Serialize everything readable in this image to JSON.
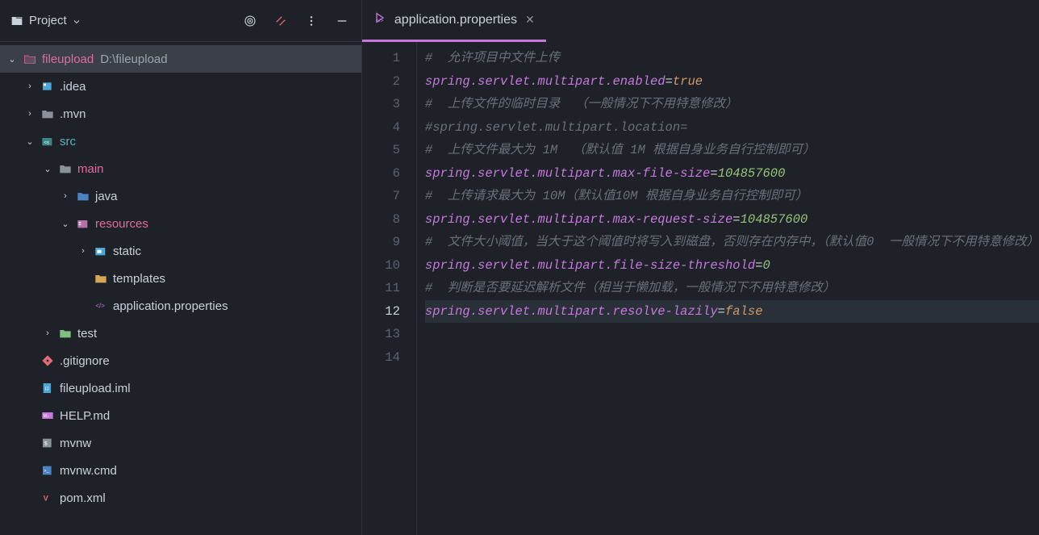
{
  "sidebar": {
    "title": "Project",
    "icons": {
      "target": "target-icon",
      "collapse": "collapse-icon",
      "more": "more-icon",
      "minimize": "minimize-icon"
    }
  },
  "tree": [
    {
      "indent": 0,
      "arrow": "down",
      "icon": "folder-pink",
      "name": "fileupload",
      "nameClass": "t-pink",
      "extra": "D:\\fileupload",
      "extraClass": "t-gray",
      "interact": true
    },
    {
      "indent": 1,
      "arrow": "right",
      "icon": "folder-idea",
      "name": ".idea",
      "nameClass": "t-white",
      "interact": true
    },
    {
      "indent": 1,
      "arrow": "right",
      "icon": "folder-gray",
      "name": ".mvn",
      "nameClass": "t-white",
      "interact": true
    },
    {
      "indent": 1,
      "arrow": "down",
      "icon": "folder-src",
      "name": "src",
      "nameClass": "t-cyan",
      "interact": true
    },
    {
      "indent": 2,
      "arrow": "down",
      "icon": "folder-gray",
      "name": "main",
      "nameClass": "t-pink",
      "interact": true
    },
    {
      "indent": 3,
      "arrow": "right",
      "icon": "folder-blue",
      "name": "java",
      "nameClass": "t-white",
      "interact": true
    },
    {
      "indent": 3,
      "arrow": "down",
      "icon": "folder-res",
      "name": "resources",
      "nameClass": "t-pink",
      "interact": true
    },
    {
      "indent": 4,
      "arrow": "right",
      "icon": "folder-static",
      "name": "static",
      "nameClass": "t-white",
      "interact": true
    },
    {
      "indent": 4,
      "arrow": "empty",
      "icon": "folder-yellow",
      "name": "templates",
      "nameClass": "t-white",
      "interact": true
    },
    {
      "indent": 4,
      "arrow": "empty",
      "icon": "file-props",
      "name": "application.properties",
      "nameClass": "t-white",
      "interact": true
    },
    {
      "indent": 2,
      "arrow": "right",
      "icon": "folder-test",
      "name": "test",
      "nameClass": "t-white",
      "interact": true
    },
    {
      "indent": 1,
      "arrow": "empty",
      "icon": "file-git",
      "name": ".gitignore",
      "nameClass": "t-white",
      "interact": true
    },
    {
      "indent": 1,
      "arrow": "empty",
      "icon": "file-iml",
      "name": "fileupload.iml",
      "nameClass": "t-white",
      "interact": true
    },
    {
      "indent": 1,
      "arrow": "empty",
      "icon": "file-md",
      "name": "HELP.md",
      "nameClass": "t-white",
      "interact": true
    },
    {
      "indent": 1,
      "arrow": "empty",
      "icon": "file-sh",
      "name": "mvnw",
      "nameClass": "t-white",
      "interact": true
    },
    {
      "indent": 1,
      "arrow": "empty",
      "icon": "file-cmd",
      "name": "mvnw.cmd",
      "nameClass": "t-white",
      "interact": true
    },
    {
      "indent": 1,
      "arrow": "empty",
      "icon": "file-xml",
      "name": "pom.xml",
      "nameClass": "t-white",
      "interact": true
    }
  ],
  "tab": {
    "label": "application.properties"
  },
  "code": [
    {
      "n": 1,
      "cur": false,
      "seg": [
        {
          "t": "#  允许项目中文件上传",
          "c": "c-comment"
        }
      ]
    },
    {
      "n": 2,
      "cur": false,
      "seg": [
        {
          "t": "spring.servlet.multipart.enabled",
          "c": "c-key"
        },
        {
          "t": "=",
          "c": "c-eq"
        },
        {
          "t": "true",
          "c": "c-val"
        }
      ]
    },
    {
      "n": 3,
      "cur": false,
      "seg": [
        {
          "t": "#  上传文件的临时目录  （一般情况下不用特意修改）",
          "c": "c-comment"
        }
      ]
    },
    {
      "n": 4,
      "cur": false,
      "seg": [
        {
          "t": "#spring.servlet.multipart.location=",
          "c": "c-comment"
        }
      ]
    },
    {
      "n": 5,
      "cur": false,
      "seg": [
        {
          "t": "#  上传文件最大为 ",
          "c": "c-comment"
        },
        {
          "t": "1M",
          "c": "c-comment"
        },
        {
          "t": "  （默认值 ",
          "c": "c-comment"
        },
        {
          "t": "1M",
          "c": "c-comment"
        },
        {
          "t": " 根据自身业务自行控制即可）",
          "c": "c-comment"
        }
      ]
    },
    {
      "n": 6,
      "cur": false,
      "seg": [
        {
          "t": "spring.servlet.multipart.max-file-size",
          "c": "c-key"
        },
        {
          "t": "=",
          "c": "c-eq"
        },
        {
          "t": "104857600",
          "c": "c-num"
        }
      ]
    },
    {
      "n": 7,
      "cur": false,
      "seg": [
        {
          "t": "#  上传请求最大为 ",
          "c": "c-comment"
        },
        {
          "t": "10M",
          "c": "c-comment"
        },
        {
          "t": "（默认值",
          "c": "c-comment"
        },
        {
          "t": "10M",
          "c": "c-comment"
        },
        {
          "t": " 根据自身业务自行控制即可）",
          "c": "c-comment"
        }
      ]
    },
    {
      "n": 8,
      "cur": false,
      "seg": [
        {
          "t": "spring.servlet.multipart.max-request-size",
          "c": "c-key"
        },
        {
          "t": "=",
          "c": "c-eq"
        },
        {
          "t": "104857600",
          "c": "c-num"
        }
      ]
    },
    {
      "n": 9,
      "cur": false,
      "seg": [
        {
          "t": "#  文件大小阈值，当大于这个阈值时将写入到磁盘，否则存在内存中，（默认值",
          "c": "c-comment"
        },
        {
          "t": "0",
          "c": "c-comment"
        },
        {
          "t": "  一般情况下不用特意修改）",
          "c": "c-comment"
        }
      ]
    },
    {
      "n": 10,
      "cur": false,
      "seg": [
        {
          "t": "spring.servlet.multipart.file-size-threshold",
          "c": "c-key"
        },
        {
          "t": "=",
          "c": "c-eq"
        },
        {
          "t": "0",
          "c": "c-num"
        }
      ]
    },
    {
      "n": 11,
      "cur": false,
      "seg": [
        {
          "t": "#  判断是否要延迟解析文件（相当于懒加载，一般情况下不用特意修改）",
          "c": "c-comment"
        }
      ]
    },
    {
      "n": 12,
      "cur": true,
      "seg": [
        {
          "t": "spring.servlet.multipart.resolve-lazily",
          "c": "c-key"
        },
        {
          "t": "=",
          "c": "c-eq"
        },
        {
          "t": "false",
          "c": "c-val"
        }
      ]
    },
    {
      "n": 13,
      "cur": false,
      "seg": []
    },
    {
      "n": 14,
      "cur": false,
      "seg": []
    }
  ]
}
